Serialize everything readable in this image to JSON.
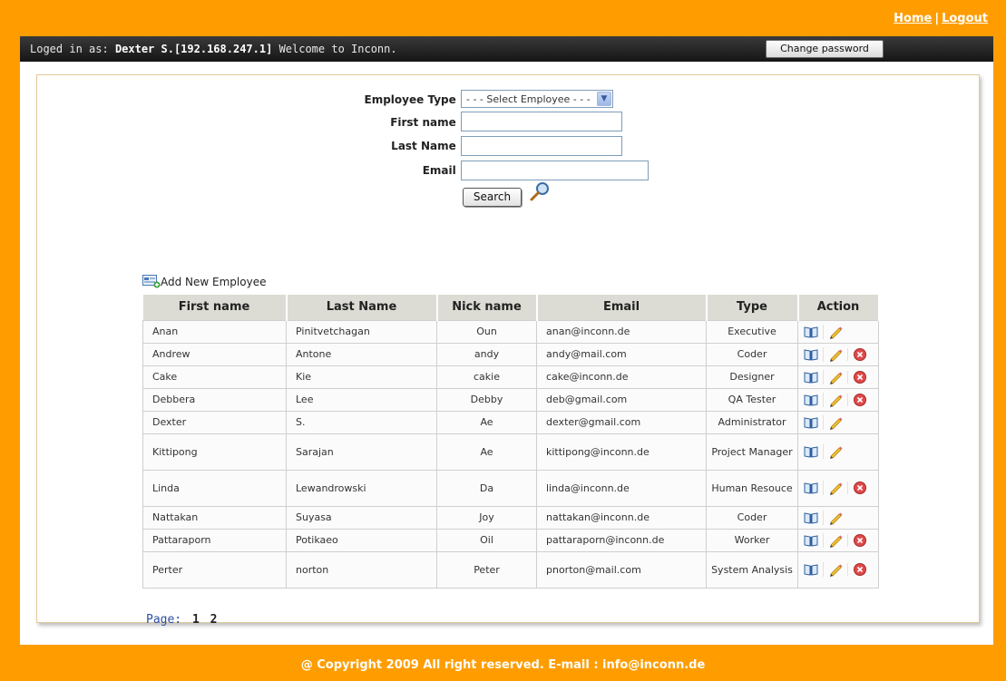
{
  "top_links": {
    "home": "Home",
    "separator": "|",
    "logout": "Logout"
  },
  "userbar": {
    "prefix": "Loged in as:",
    "user": "Dexter S.[192.168.247.1]",
    "welcome": "Welcome to Inconn.",
    "change_password": "Change password"
  },
  "search_form": {
    "employee_type_label": "Employee Type",
    "employee_type_value": "- - - Select Employee - - -",
    "first_name_label": "First name",
    "last_name_label": "Last Name",
    "email_label": "Email",
    "colon": ":",
    "search_button": "Search"
  },
  "add_employee": "Add New Employee",
  "table": {
    "headers": [
      "First name",
      "Last Name",
      "Nick name",
      "Email",
      "Type",
      "Action"
    ],
    "rows": [
      {
        "first": "Anan",
        "last": "Pinitvetchagan",
        "nick": "Oun",
        "email": "anan@inconn.de",
        "type": "Executive",
        "view": true,
        "edit": true,
        "del": false
      },
      {
        "first": "Andrew",
        "last": "Antone",
        "nick": "andy",
        "email": "andy@mail.com",
        "type": "Coder",
        "view": true,
        "edit": true,
        "del": true
      },
      {
        "first": "Cake",
        "last": "Kie",
        "nick": "cakie",
        "email": "cake@inconn.de",
        "type": "Designer",
        "view": true,
        "edit": true,
        "del": true
      },
      {
        "first": "Debbera",
        "last": "Lee",
        "nick": "Debby",
        "email": "deb@gmail.com",
        "type": "QA Tester",
        "view": true,
        "edit": true,
        "del": true
      },
      {
        "first": "Dexter",
        "last": "S.",
        "nick": "Ae",
        "email": "dexter@gmail.com",
        "type": "Administrator",
        "view": true,
        "edit": true,
        "del": false
      },
      {
        "first": "Kittipong",
        "last": "Sarajan",
        "nick": "Ae",
        "email": "kittipong@inconn.de",
        "type": "Project Manager",
        "view": true,
        "edit": true,
        "del": false
      },
      {
        "first": "Linda",
        "last": "Lewandrowski",
        "nick": "Da",
        "email": "linda@inconn.de",
        "type": "Human Resouce",
        "view": true,
        "edit": true,
        "del": true
      },
      {
        "first": "Nattakan",
        "last": "Suyasa",
        "nick": "Joy",
        "email": "nattakan@inconn.de",
        "type": "Coder",
        "view": true,
        "edit": true,
        "del": false
      },
      {
        "first": "Pattaraporn",
        "last": "Potikaeo",
        "nick": "Oil",
        "email": "pattaraporn@inconn.de",
        "type": "Worker",
        "view": true,
        "edit": true,
        "del": true
      },
      {
        "first": "Perter",
        "last": "norton",
        "nick": "Peter",
        "email": "pnorton@mail.com",
        "type": "System Analysis",
        "view": true,
        "edit": true,
        "del": true
      }
    ]
  },
  "pager": {
    "label": "Page:",
    "pages": [
      "1",
      "2"
    ]
  },
  "footer": "@ Copyright 2009 All right reserved. E-mail : info@inconn.de",
  "colors": {
    "frame": "#ff9d00",
    "userbar": "#1e1e1e",
    "header_bg": "#dcdcd4"
  }
}
